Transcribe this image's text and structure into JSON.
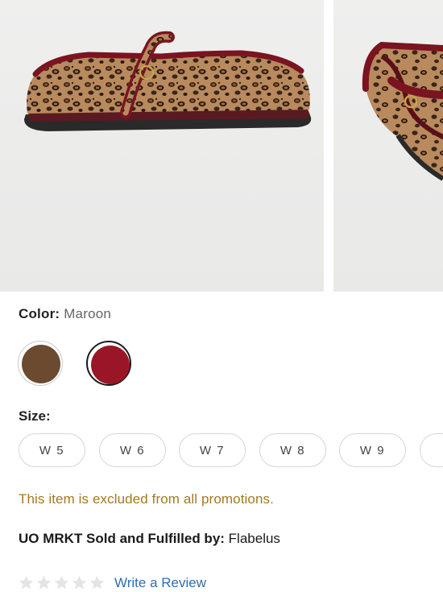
{
  "product": {
    "images": [
      {
        "icon": "flat-shoe-side-view"
      },
      {
        "icon": "flat-shoe-angled-view"
      }
    ]
  },
  "color": {
    "label": "Color:",
    "selected": "Maroon",
    "swatches": [
      {
        "hex": "#6b4a30",
        "selected": false
      },
      {
        "hex": "#9a1626",
        "selected": true
      }
    ]
  },
  "size": {
    "label": "Size:",
    "options": [
      "W 5",
      "W 6",
      "W 7",
      "W 8",
      "W 9"
    ]
  },
  "promo_note": "This item is excluded from all promotions.",
  "seller": {
    "label": "UO MRKT Sold and Fulfilled by:",
    "name": "Flabelus"
  },
  "reviews": {
    "star_count": 5,
    "rating": 0,
    "link": "Write a Review"
  },
  "colors": {
    "promo": "#a37a1e",
    "link": "#2f6fad",
    "star_empty": "#e4e4e4",
    "maroon": "#9a1626",
    "brown": "#6b4a30"
  }
}
